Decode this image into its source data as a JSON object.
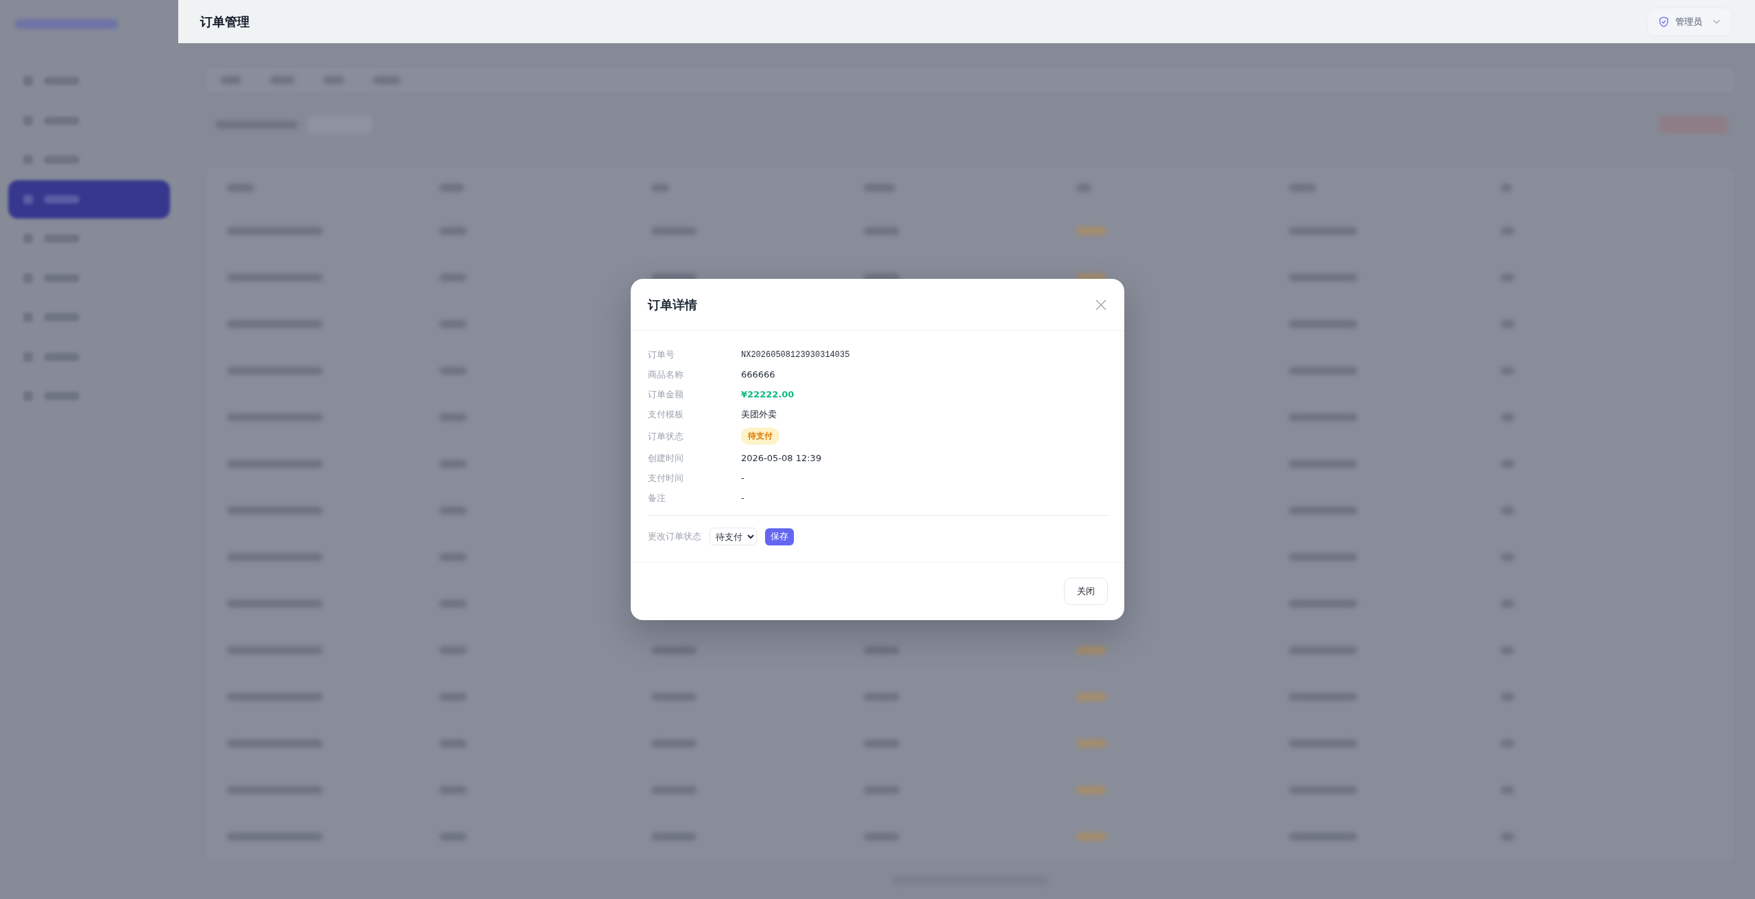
{
  "header": {
    "title": "订单管理",
    "user": {
      "label": "管理员"
    }
  },
  "dialog": {
    "title": "订单详情",
    "fields": [
      {
        "label": "订单号",
        "value": "NX20260508123930314035",
        "kind": "mono"
      },
      {
        "label": "商品名称",
        "value": "666666",
        "kind": "text"
      },
      {
        "label": "订单金额",
        "value": "¥22222.00",
        "kind": "amount"
      },
      {
        "label": "支付模板",
        "value": "美团外卖",
        "kind": "text"
      },
      {
        "label": "订单状态",
        "value": "待支付",
        "kind": "badge"
      },
      {
        "label": "创建时间",
        "value": "2026-05-08 12:39",
        "kind": "text"
      },
      {
        "label": "支付时间",
        "value": "-",
        "kind": "text"
      },
      {
        "label": "备注",
        "value": "-",
        "kind": "text"
      }
    ],
    "status_change": {
      "label": "更改订单状态",
      "value": "待支付",
      "button": "保存"
    },
    "buttons": [
      "关闭"
    ]
  }
}
